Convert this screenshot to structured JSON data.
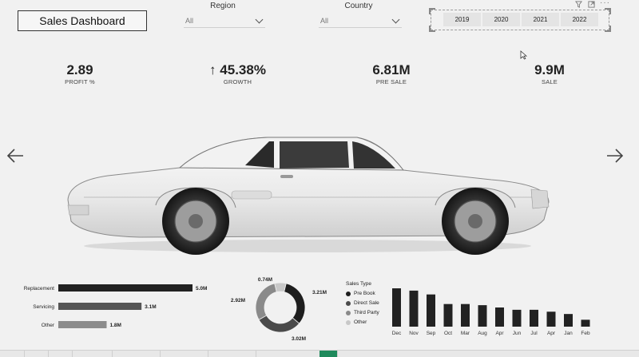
{
  "header": {
    "title": "Sales Dashboard"
  },
  "filters": {
    "region": {
      "label": "Region",
      "value": "All"
    },
    "country": {
      "label": "Country",
      "value": "All"
    }
  },
  "years": [
    "2019",
    "2020",
    "2021",
    "2022"
  ],
  "kpis": [
    {
      "value": "2.89",
      "label": "PROFIT %"
    },
    {
      "value": "45.38%",
      "label": "GROWTH",
      "trend": "up"
    },
    {
      "value": "6.81M",
      "label": "PRE SALE"
    },
    {
      "value": "9.9M",
      "label": "SALE"
    }
  ],
  "colors": {
    "background": "#f1f1f1",
    "bar_dark": "#222222",
    "bar_mid": "#555555",
    "bar_light": "#8c8c8c"
  },
  "icons": [
    "filter-icon",
    "focus-mode-icon",
    "more-options-icon",
    "arrow-left-icon",
    "arrow-right-icon"
  ],
  "chart_data": [
    {
      "type": "bar",
      "orientation": "horizontal",
      "categories": [
        "Replacement",
        "Servicing",
        "Other"
      ],
      "values": [
        5.0,
        3.1,
        1.8
      ],
      "data_labels": [
        "5.0M",
        "3.1M",
        "1.8M"
      ],
      "colors": [
        "#222222",
        "#555555",
        "#8c8c8c"
      ]
    },
    {
      "type": "pie",
      "donut": true,
      "title": "Sales Type",
      "categories": [
        "Pre Book",
        "Direct Sale",
        "Third Party",
        "Other"
      ],
      "values": [
        3.21,
        3.02,
        2.92,
        0.74
      ],
      "data_labels": [
        "3.21M",
        "3.02M",
        "2.92M",
        "0.74M"
      ],
      "colors": [
        "#1e1e1e",
        "#4a4a4a",
        "#8a8a8a",
        "#c8c8c8"
      ],
      "legend_position": "right"
    },
    {
      "type": "bar",
      "categories": [
        "Dec",
        "Nov",
        "Sep",
        "Oct",
        "Mar",
        "Aug",
        "Apr",
        "Jun",
        "Jul",
        "Apr",
        "Jan",
        "Feb"
      ],
      "values": [
        100,
        94,
        84,
        59,
        59,
        56,
        50,
        44,
        44,
        39,
        33,
        18
      ],
      "color": "#222222"
    }
  ]
}
